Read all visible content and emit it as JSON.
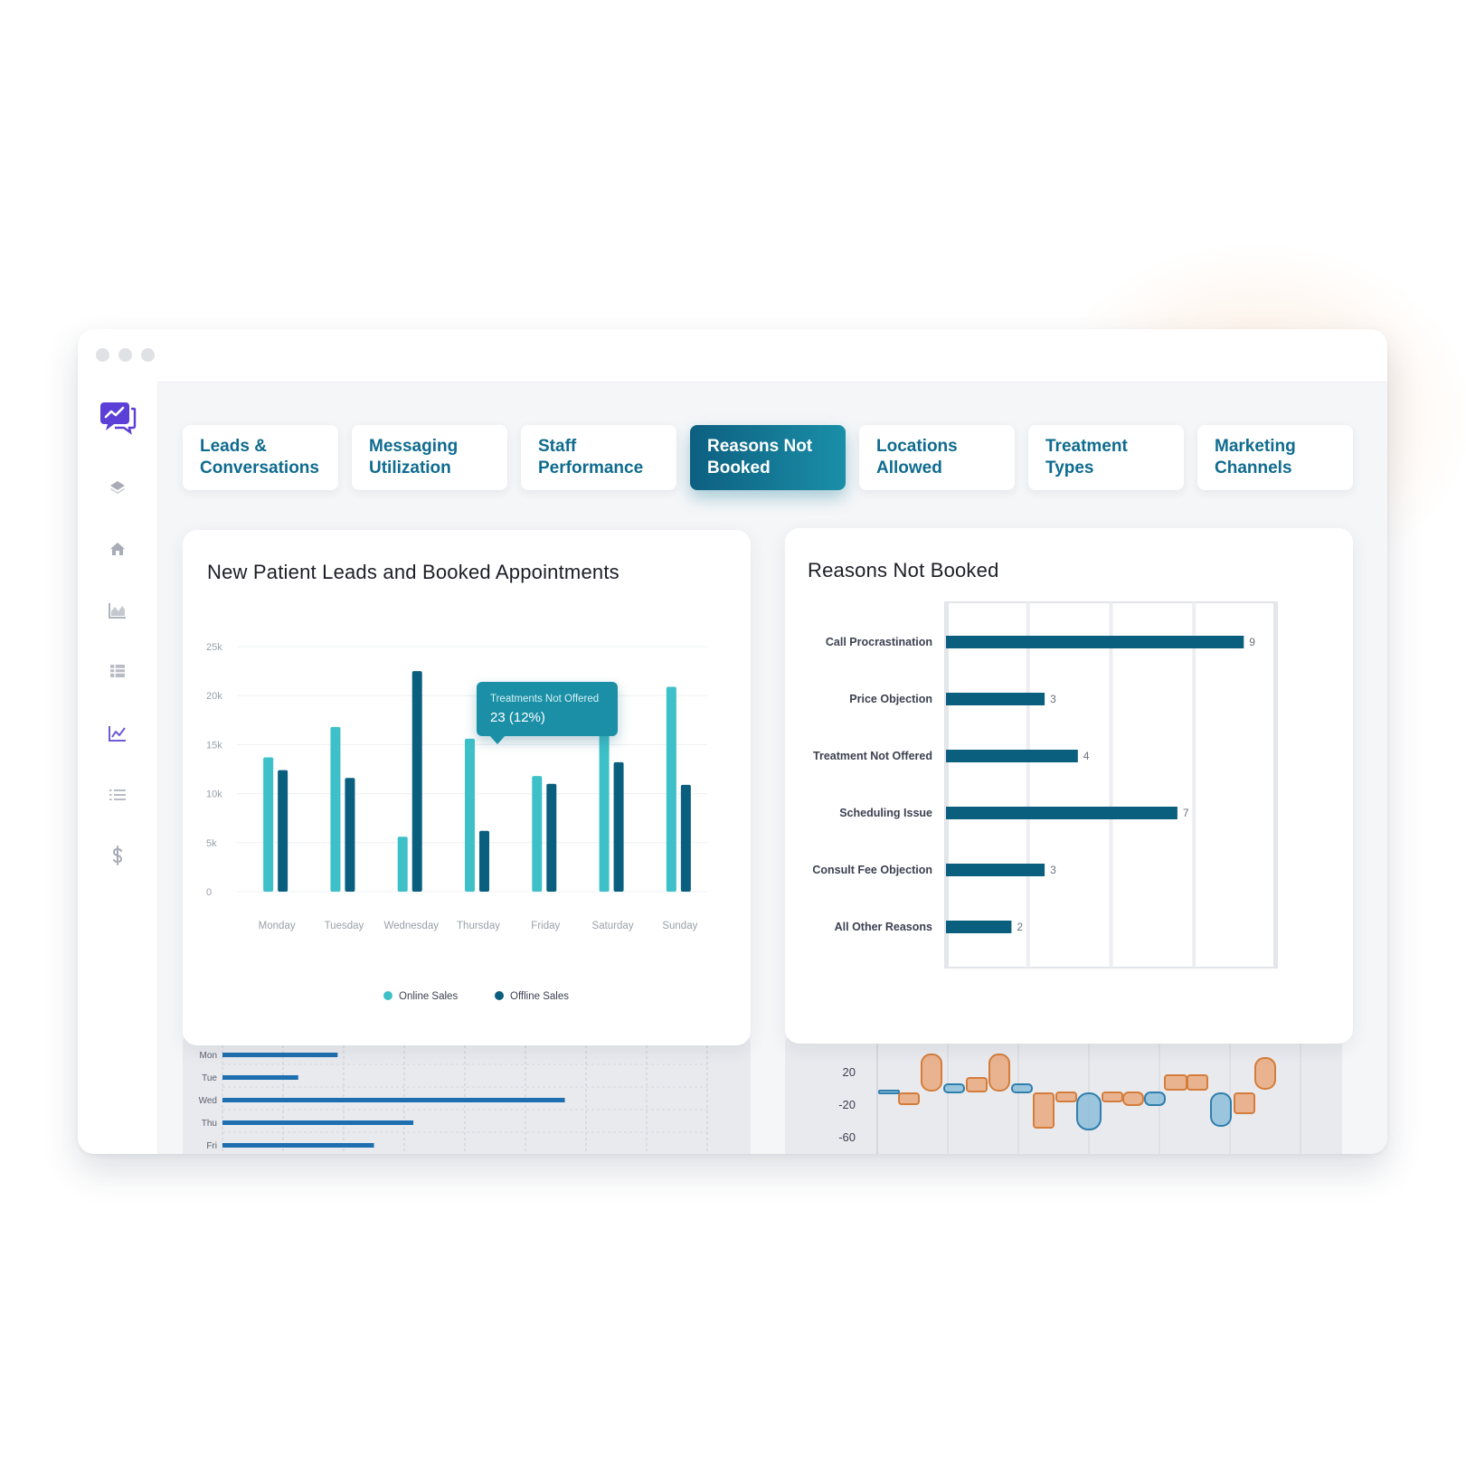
{
  "tabs": [
    {
      "label": "Leads & Conversations"
    },
    {
      "label": "Messaging Utilization"
    },
    {
      "label": "Staff Performance"
    },
    {
      "label": "Reasons Not Booked",
      "active": true
    },
    {
      "label": "Locations Allowed"
    },
    {
      "label": "Treatment Types"
    },
    {
      "label": "Marketing Channels"
    }
  ],
  "sidebar": {
    "icons": [
      "chat-chart-logo-icon",
      "layers-icon",
      "home-icon",
      "area-chart-icon",
      "table-icon",
      "line-chart-icon",
      "list-icon",
      "dollar-icon"
    ]
  },
  "left_card": {
    "title": "New Patient Leads and Booked Appointments",
    "tooltip": {
      "title": "Treatments Not Offered",
      "value": "23 (12%)"
    }
  },
  "right_card": {
    "title": "Reasons Not Booked"
  },
  "colors": {
    "online": "#3ec0c9",
    "offline": "#0b5f7e",
    "accent": "#0f6b8f",
    "bar_blue": "#1e6fb0",
    "box_orange": "#e8a070",
    "box_blue": "#7fb8d6"
  },
  "chart_data": [
    {
      "type": "bar",
      "title": "New Patient Leads and Booked Appointments",
      "categories": [
        "Monday",
        "Tuesday",
        "Wednesday",
        "Thursday",
        "Friday",
        "Saturday",
        "Sunday"
      ],
      "series": [
        {
          "name": "Online Sales",
          "values": [
            13700,
            16800,
            5600,
            15600,
            11800,
            16500,
            20900
          ]
        },
        {
          "name": "Offline Sales",
          "values": [
            12400,
            11600,
            22500,
            6200,
            11000,
            13200,
            10900
          ]
        }
      ],
      "ylim": [
        0,
        25000
      ],
      "yticks": [
        "0",
        "5k",
        "10k",
        "15k",
        "20k",
        "25k"
      ],
      "grid": true,
      "legend": "bottom"
    },
    {
      "type": "bar",
      "title": "Reasons Not Booked",
      "orientation": "horizontal",
      "categories": [
        "Call Procrastination",
        "Price Objection",
        "Treatment Not Offered",
        "Scheduling Issue",
        "Consult Fee Objection",
        "All Other Reasons"
      ],
      "values": [
        9,
        3,
        4,
        7,
        3,
        2
      ],
      "xlim": [
        0,
        10
      ],
      "grid": true
    },
    {
      "type": "bar",
      "orientation": "horizontal",
      "categories": [
        "Mon",
        "Tue",
        "Wed",
        "Thu",
        "Fri"
      ],
      "values": [
        19,
        12.5,
        56.5,
        31.5,
        25
      ],
      "xlim": [
        0,
        80
      ]
    },
    {
      "type": "scatter",
      "yticks": [
        "20",
        "-20",
        "-60"
      ],
      "ylim": [
        -70,
        40
      ]
    }
  ]
}
